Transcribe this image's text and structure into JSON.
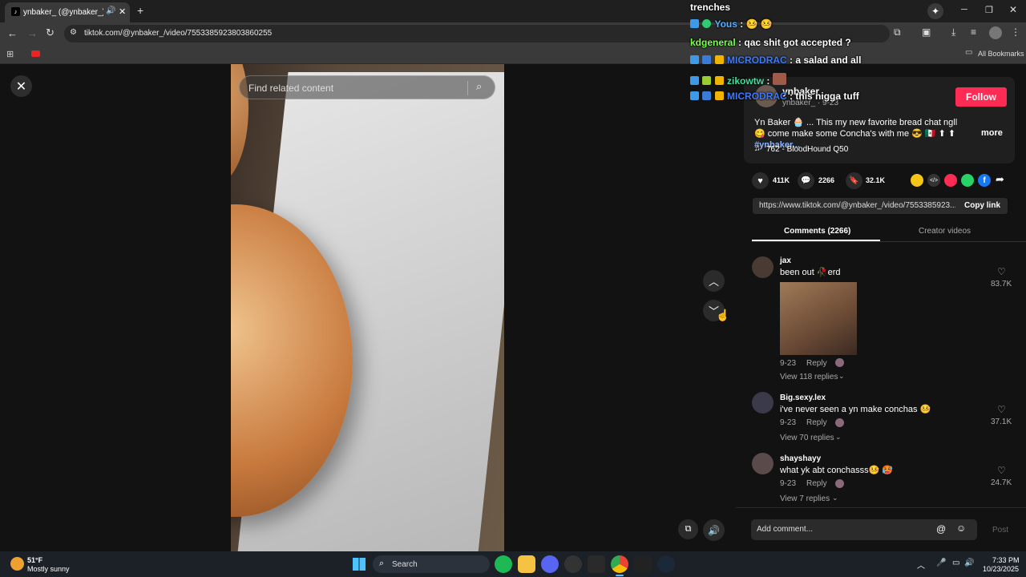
{
  "browser": {
    "tab_title": "ynbaker_ (@ynbaker_) | Tik",
    "url": "tiktok.com/@ynbaker_/video/7553385923803860255",
    "all_bookmarks": "All Bookmarks"
  },
  "video": {
    "search_placeholder": "Find related content"
  },
  "chat": {
    "header": "trenches",
    "lines": [
      {
        "user": "Yous",
        "user_color": "#5ab0ff",
        "message": ":"
      },
      {
        "user": "kdgeneral",
        "user_color": "#7cff4f",
        "message": ": qac shit got accepted ?"
      },
      {
        "user": "MICRODRAC",
        "user_color": "#3d7bff",
        "message": ": a salad and all"
      },
      {
        "user": "zikowtw",
        "user_color": "#3fe0a0",
        "message": ":"
      },
      {
        "user": "MICRODRAC",
        "user_color": "#3d7bff",
        "message": ": this nigga tuff"
      }
    ]
  },
  "author": {
    "name": "ynbaker_",
    "handle_date": "ynbaker_ · 9-23",
    "follow_label": "Follow",
    "caption": "Yn Baker 🧁 ... This my new favorite bread chat ngll 😋 come make some Concha's with me 😎 🇲🇽 ⬆ ⬆",
    "hashtag": "#ynbaker...",
    "more_label": "more",
    "music": "762 - BloodHound Q50"
  },
  "stats": {
    "likes": "411K",
    "comments": "2266",
    "saves": "32.1K"
  },
  "share": {
    "link": "https://www.tiktok.com/@ynbaker_/video/7553385923...",
    "copy_label": "Copy link"
  },
  "tabs": {
    "comments": "Comments (2266)",
    "creator_videos": "Creator videos"
  },
  "comments": [
    {
      "user": "jax",
      "text": "been out 🥀erd",
      "date": "9-23",
      "reply": "Reply",
      "likes": "83.7K",
      "view_replies": "View 118 replies"
    },
    {
      "user": "Big.sexy.lex",
      "text": "i've never seen a yn make conchas 🤒",
      "date": "9-23",
      "reply": "Reply",
      "likes": "37.1K",
      "view_replies": "View 70 replies"
    },
    {
      "user": "shayshayy",
      "text": "what yk abt conchasss🤒 🥵",
      "date": "9-23",
      "reply": "Reply",
      "likes": "24.7K",
      "view_replies": "View 7 replies"
    }
  ],
  "comment_input": {
    "placeholder": "Add comment...",
    "post_label": "Post"
  },
  "taskbar": {
    "temp": "51°F",
    "weather": "Mostly sunny",
    "search": "Search",
    "time": "7:33 PM",
    "date": "10/23/2025"
  },
  "colors": {
    "follow": "#fe2c55",
    "background": "#121212"
  }
}
